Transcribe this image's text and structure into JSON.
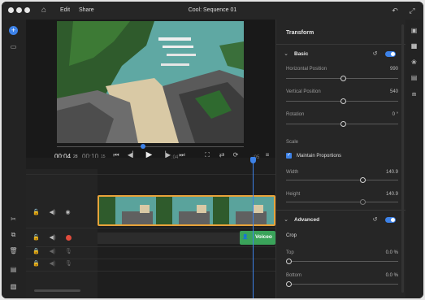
{
  "window": {
    "title": "Cool: Sequence 01"
  },
  "menu": {
    "edit": "Edit",
    "share": "Share"
  },
  "playback": {
    "current_time": "00:04",
    "current_frames": "28",
    "duration": "00:10",
    "duration_frames": "15",
    "ruler_mark": ":04",
    "playhead_label": ":05"
  },
  "clips": {
    "voiceover": "Voiceo"
  },
  "panel": {
    "title": "Transform",
    "basic": {
      "label": "Basic",
      "horizontal_label": "Horizontal Position",
      "horizontal_value": "990",
      "vertical_label": "Vertical Position",
      "vertical_value": "540",
      "rotation_label": "Rotation",
      "rotation_value": "0 °",
      "scale_label": "Scale",
      "maintain_label": "Maintain Proportions",
      "width_label": "Width",
      "width_value": "140.9",
      "height_label": "Height",
      "height_value": "140.9"
    },
    "advanced": {
      "label": "Advanced",
      "crop_label": "Crop",
      "top_label": "Top",
      "top_value": "0.0 %",
      "bottom_label": "Bottom",
      "bottom_value": "0.0 %"
    }
  },
  "colors": {
    "accent": "#3d82e8",
    "clip_border": "#e8a33a",
    "audio_clip": "#3aa35a"
  }
}
